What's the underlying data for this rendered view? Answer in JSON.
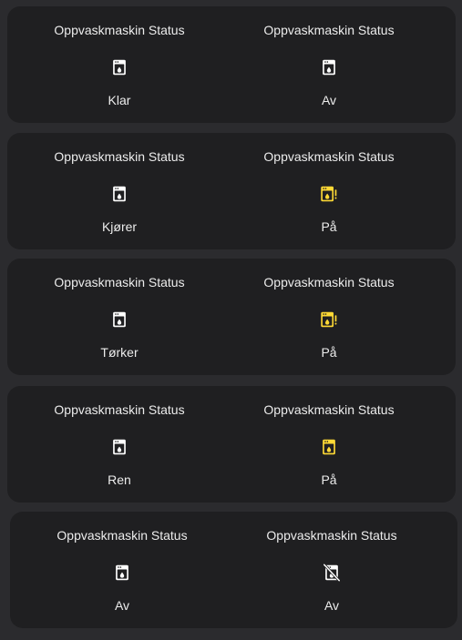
{
  "colors": {
    "background": "#2b2b2e",
    "card": "#1f1f21",
    "text": "#ececec",
    "icon_default": "#ffffff",
    "icon_active": "#fdd835"
  },
  "rows": [
    {
      "left": {
        "title": "Oppvaskmaskin Status",
        "state": "Klar",
        "icon": "dishwasher-icon"
      },
      "right": {
        "title": "Oppvaskmaskin Status",
        "state": "Av",
        "icon": "dishwasher-icon"
      }
    },
    {
      "left": {
        "title": "Oppvaskmaskin Status",
        "state": "Kjører",
        "icon": "dishwasher-icon"
      },
      "right": {
        "title": "Oppvaskmaskin Status",
        "state": "På",
        "icon": "dishwasher-alert-icon"
      }
    },
    {
      "left": {
        "title": "Oppvaskmaskin Status",
        "state": "Tørker",
        "icon": "dishwasher-icon"
      },
      "right": {
        "title": "Oppvaskmaskin Status",
        "state": "På",
        "icon": "dishwasher-alert-icon"
      }
    },
    {
      "left": {
        "title": "Oppvaskmaskin Status",
        "state": "Ren",
        "icon": "dishwasher-icon"
      },
      "right": {
        "title": "Oppvaskmaskin Status",
        "state": "På",
        "icon": "dishwasher-active-icon"
      }
    },
    {
      "left": {
        "title": "Oppvaskmaskin Status",
        "state": "Av",
        "icon": "dishwasher-icon"
      },
      "right": {
        "title": "Oppvaskmaskin Status",
        "state": "Av",
        "icon": "dishwasher-off-icon"
      }
    }
  ]
}
